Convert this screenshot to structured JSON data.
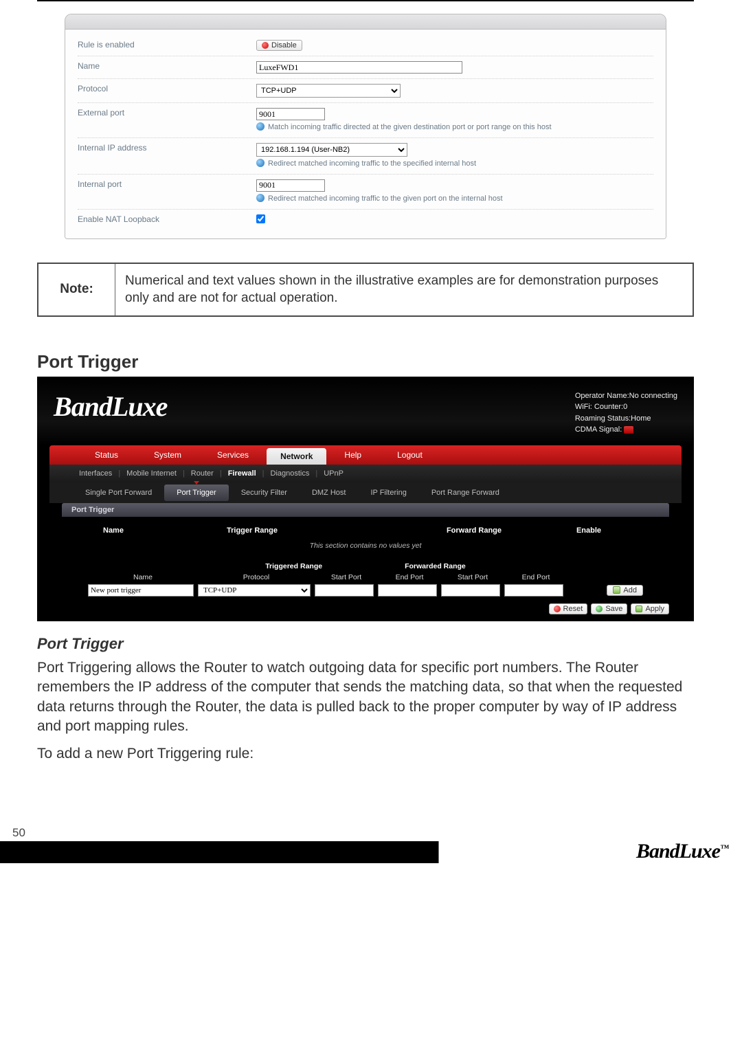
{
  "panel1": {
    "rows": {
      "rule_enabled": {
        "label": "Rule is enabled",
        "button": "Disable"
      },
      "name": {
        "label": "Name",
        "value": "LuxeFWD1"
      },
      "protocol": {
        "label": "Protocol",
        "value": "TCP+UDP"
      },
      "ext_port": {
        "label": "External port",
        "value": "9001",
        "hint": "Match incoming traffic directed at the given destination port or port range on this host"
      },
      "int_ip": {
        "label": "Internal IP address",
        "value": "192.168.1.194 (User-NB2)",
        "hint": "Redirect matched incoming traffic to the specified internal host"
      },
      "int_port": {
        "label": "Internal port",
        "value": "9001",
        "hint": "Redirect matched incoming traffic to the given port on the internal host"
      },
      "nat_loop": {
        "label": "Enable NAT Loopback"
      }
    }
  },
  "note": {
    "label": "Note:",
    "text": "Numerical and text values shown in the illustrative examples are for demonstration purposes only and are not for actual operation."
  },
  "section_title": "Port Trigger",
  "bandluxe": {
    "logo": "BandLuxe",
    "status": {
      "l1": "Operator Name:No connecting",
      "l2": "WiFi: Counter:0",
      "l3": "Roaming Status:Home",
      "l4": "CDMA Signal:"
    },
    "nav": [
      "Status",
      "System",
      "Services",
      "Network",
      "Help",
      "Logout"
    ],
    "nav_active_index": 3,
    "subnav": [
      "Interfaces",
      "Mobile Internet",
      "Router",
      "Firewall",
      "Diagnostics",
      "UPnP"
    ],
    "subnav_bold_index": 3,
    "subtabs": [
      "Single Port Forward",
      "Port Trigger",
      "Security Filter",
      "DMZ Host",
      "IP Filtering",
      "Port Range Forward"
    ],
    "subtab_active_index": 1,
    "pt": {
      "title": "Port Trigger",
      "head": {
        "name": "Name",
        "trig": "Trigger Range",
        "fwd": "Forward Range",
        "en": "Enable"
      },
      "empty": "This section contains no values yet",
      "range_h": {
        "trig": "Triggered Range",
        "fwd": "Forwarded Range"
      },
      "cols": {
        "name": "Name",
        "proto": "Protocol",
        "sp": "Start Port",
        "ep": "End Port"
      },
      "input": {
        "name": "New port trigger",
        "proto": "TCP+UDP"
      },
      "add": "Add",
      "buttons": {
        "reset": "Reset",
        "save": "Save",
        "apply": "Apply"
      }
    }
  },
  "subhead": "Port Trigger",
  "para1": "Port Triggering allows the Router to watch outgoing data for specific port numbers. The Router remembers the IP address of the computer that sends the matching data, so that when the requested data returns through the Router, the data is pulled back to the proper computer by way of IP address and port mapping rules.",
  "para2": "To add a new Port Triggering rule:",
  "page_number": "50",
  "footer_logo": "BandLuxe",
  "tm": "™"
}
